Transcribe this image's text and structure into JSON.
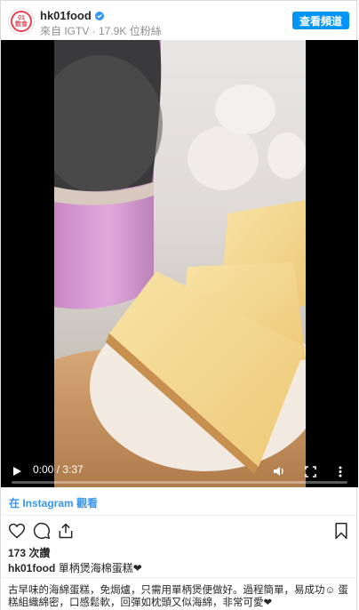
{
  "header": {
    "username": "hk01food",
    "avatar_text_line1": "01",
    "avatar_text_line2": "飲食",
    "source_line": "來自 IGTV · 17.9K 位粉絲",
    "view_channel_label": "查看頻道"
  },
  "video": {
    "time_display": "0:00 / 3:37",
    "progress_fraction": 0.0
  },
  "watch_on_instagram": "在 Instagram 觀看",
  "likes": "173 次讚",
  "caption": {
    "username": "hk01food",
    "text": "單柄煲海棉蛋糕❤"
  },
  "description": "古早味的海綿蛋糕，免焗爐，只需用單柄煲便做好。過程簡單，易成功☺ 蛋糕組織綿密，口感鬆軟，回彈如枕頭又似海綿，非常可愛❤",
  "colors": {
    "accent": "#0095f6",
    "link": "#3897f0",
    "brand_red": "#e8434f",
    "pot_pink": "#d69ad0",
    "cake_yellow": "#f3d98f"
  },
  "icons": [
    "verified-badge-icon",
    "play-icon",
    "volume-icon",
    "fullscreen-icon",
    "more-vertical-icon",
    "heart-icon",
    "comment-icon",
    "share-icon",
    "bookmark-icon"
  ]
}
